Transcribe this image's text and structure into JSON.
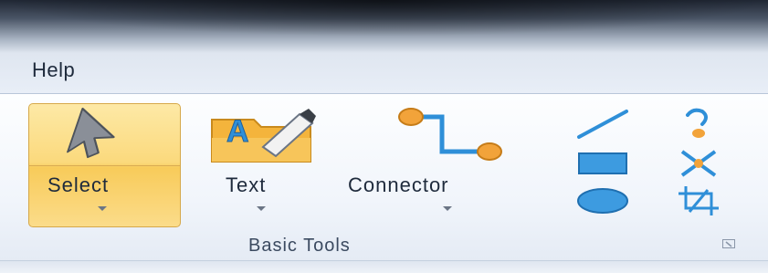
{
  "menu": {
    "help_label": "Help"
  },
  "ribbon": {
    "group_label": "Basic Tools",
    "select": {
      "label": "Select",
      "state": "active",
      "icon": "arrow-cursor-icon"
    },
    "text": {
      "label": "Text",
      "icon": "text-tool-icon"
    },
    "connector": {
      "label": "Connector",
      "icon": "connector-icon"
    },
    "small_tools": [
      {
        "name": "line-tool",
        "icon": "line-icon"
      },
      {
        "name": "rectangle-tool",
        "icon": "rectangle-icon"
      },
      {
        "name": "ellipse-tool",
        "icon": "ellipse-icon"
      },
      {
        "name": "freeform-tool",
        "icon": "freeform-icon"
      },
      {
        "name": "connection-point-tool",
        "icon": "connection-point-icon"
      },
      {
        "name": "crop-tool",
        "icon": "crop-icon"
      }
    ]
  },
  "colors": {
    "accent_blue": "#2f8fd8",
    "connector_orange": "#f2a33a",
    "active_gold": "#fbd97c"
  }
}
